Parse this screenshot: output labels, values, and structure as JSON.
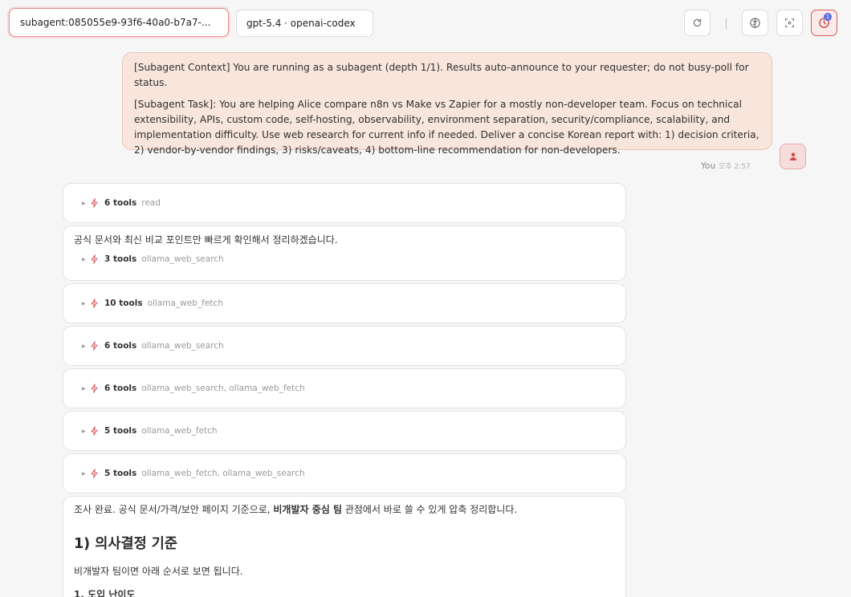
{
  "header": {
    "session_label": "subagent:085055e9-93f6-40a0-b7a7-...",
    "model_label": "gpt-5.4 · openai-codex",
    "notification_count": "1"
  },
  "user_message": {
    "context": "[Subagent Context] You are running as a subagent (depth 1/1). Results auto-announce to your requester; do not busy-poll for status.",
    "task": "[Subagent Task]: You are helping Alice compare n8n vs Make vs Zapier for a mostly non-developer team. Focus on technical extensibility, APIs, custom code, self-hosting, observability, environment separation, security/compliance, scalability, and implementation difficulty. Use web research for current info if needed. Deliver a concise Korean report with: 1) decision criteria, 2) vendor-by-vendor findings, 3) risks/caveats, 4) bottom-line recommendation for non-developers.",
    "sender": "You",
    "time": "오후 2:57"
  },
  "tool_groups": [
    {
      "count": "6 tools",
      "names": "read"
    },
    {
      "count": "3 tools",
      "names": "ollama_web_search",
      "intro": "공식 문서와 최신 비교 포인트만 빠르게 확인해서 정리하겠습니다."
    },
    {
      "count": "10 tools",
      "names": "ollama_web_fetch"
    },
    {
      "count": "6 tools",
      "names": "ollama_web_search"
    },
    {
      "count": "6 tools",
      "names": "ollama_web_search, ollama_web_fetch"
    },
    {
      "count": "5 tools",
      "names": "ollama_web_fetch"
    },
    {
      "count": "5 tools",
      "names": "ollama_web_fetch, ollama_web_search"
    }
  ],
  "report": {
    "intro_before": "조사 완료. 공식 문서/가격/보안 페이지 기준으로, ",
    "intro_bold": "비개발자 중심 팀",
    "intro_after": " 관점에서 바로 쓸 수 있게 압축 정리합니다.",
    "heading": "1) 의사결정 기준",
    "lead": "비개발자 팀이면 아래 순서로 보면 됩니다.",
    "list_item_1": "1. 도입 난이도"
  },
  "colors": {
    "accent": "#d65c5c",
    "user_bubble": "#f8e6dd",
    "badge": "#5b6ee0"
  }
}
